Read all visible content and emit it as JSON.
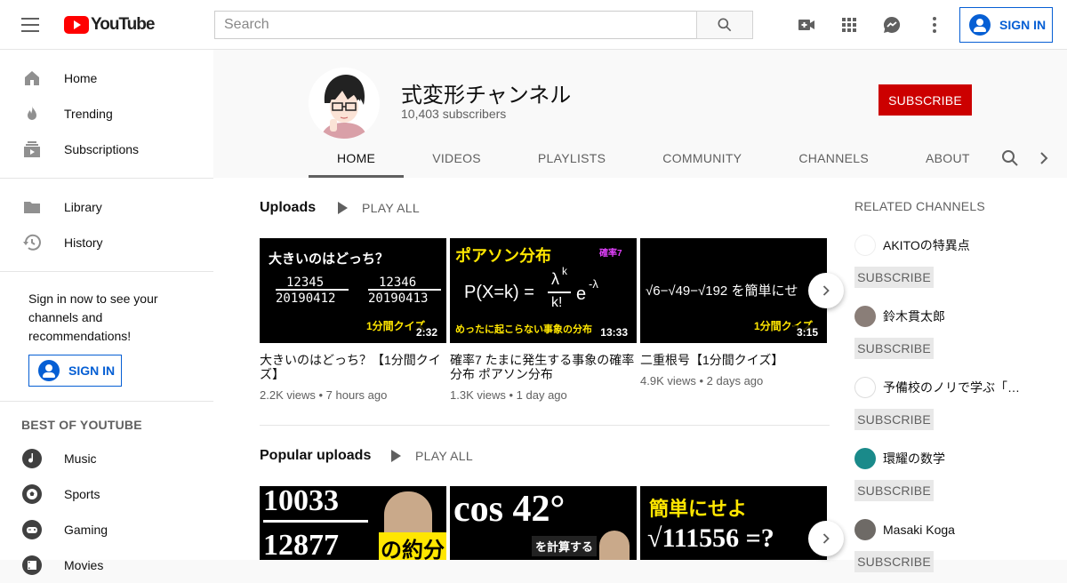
{
  "app": {
    "logo_text": "YouTube"
  },
  "search": {
    "placeholder": "Search"
  },
  "topbar": {
    "sign_in": "SIGN IN"
  },
  "sidebar": {
    "items": [
      {
        "label": "Home"
      },
      {
        "label": "Trending"
      },
      {
        "label": "Subscriptions"
      },
      {
        "label": "Library"
      },
      {
        "label": "History"
      }
    ],
    "signin_prompt": "Sign in now to see your channels and recommendations!",
    "signin_button": "SIGN IN",
    "best_of_title": "BEST OF YOUTUBE",
    "best_of": [
      {
        "label": "Music"
      },
      {
        "label": "Sports"
      },
      {
        "label": "Gaming"
      },
      {
        "label": "Movies"
      }
    ]
  },
  "channel": {
    "name": "式変形チャンネル",
    "subscribers": "10,403 subscribers",
    "subscribe": "SUBSCRIBE",
    "tabs": [
      "HOME",
      "VIDEOS",
      "PLAYLISTS",
      "COMMUNITY",
      "CHANNELS",
      "ABOUT"
    ]
  },
  "uploads": {
    "title": "Uploads",
    "play_all": "PLAY ALL",
    "videos": [
      {
        "title": "大きいのはどっち？【1分間クイズ】",
        "views": "2.2K views",
        "age": "7 hours ago",
        "duration": "2:32",
        "thumb_line1": "大きいのはどっち？",
        "thumb_a1": "12345",
        "thumb_a2": "20190412",
        "thumb_b1": "12346",
        "thumb_b2": "20190413",
        "thumb_tag": "1分間クイズ"
      },
      {
        "title": "確率7 たまに発生する事象の確率分布 ポアソン分布",
        "views": "1.3K views",
        "age": "1 day ago",
        "duration": "13:33",
        "thumb_line1": "ポアソン分布",
        "thumb_badge": "確率7",
        "thumb_formula": "P(X=k) =",
        "thumb_frac_num": "λ",
        "thumb_frac_exp": "k",
        "thumb_frac_den": "k!",
        "thumb_e": "e",
        "thumb_e_exp": "-λ",
        "thumb_bottom": "めったに起こらない事象の分布"
      },
      {
        "title": "二重根号【1分間クイズ】",
        "views": "4.9K views",
        "age": "2 days ago",
        "duration": "3:15",
        "thumb_line1": "√6−√49−√192 を簡単にせ",
        "thumb_tag": "1分間クイズ"
      }
    ]
  },
  "popular": {
    "title": "Popular uploads",
    "play_all": "PLAY ALL",
    "thumbs": [
      {
        "line1": "10033",
        "line2": "12877",
        "tag": "の約分"
      },
      {
        "line1": "cos 42°",
        "tag": "を計算する"
      },
      {
        "line1": "簡単にせよ",
        "line2": "√111556 =?"
      }
    ]
  },
  "related": {
    "title": "RELATED CHANNELS",
    "subscribe": "SUBSCRIBE",
    "channels": [
      {
        "name": "AKITOの特異点"
      },
      {
        "name": "鈴木貫太郎"
      },
      {
        "name": "予備校のノリで学ぶ「…"
      },
      {
        "name": "環耀の数学"
      },
      {
        "name": "Masaki Koga"
      }
    ]
  },
  "colors": {
    "brand_red": "#ff0000",
    "subscribe_red": "#cc0000",
    "link_blue": "#065fd4",
    "thumb_yellow": "#ffe600",
    "thumb_magenta": "#e040fb"
  }
}
